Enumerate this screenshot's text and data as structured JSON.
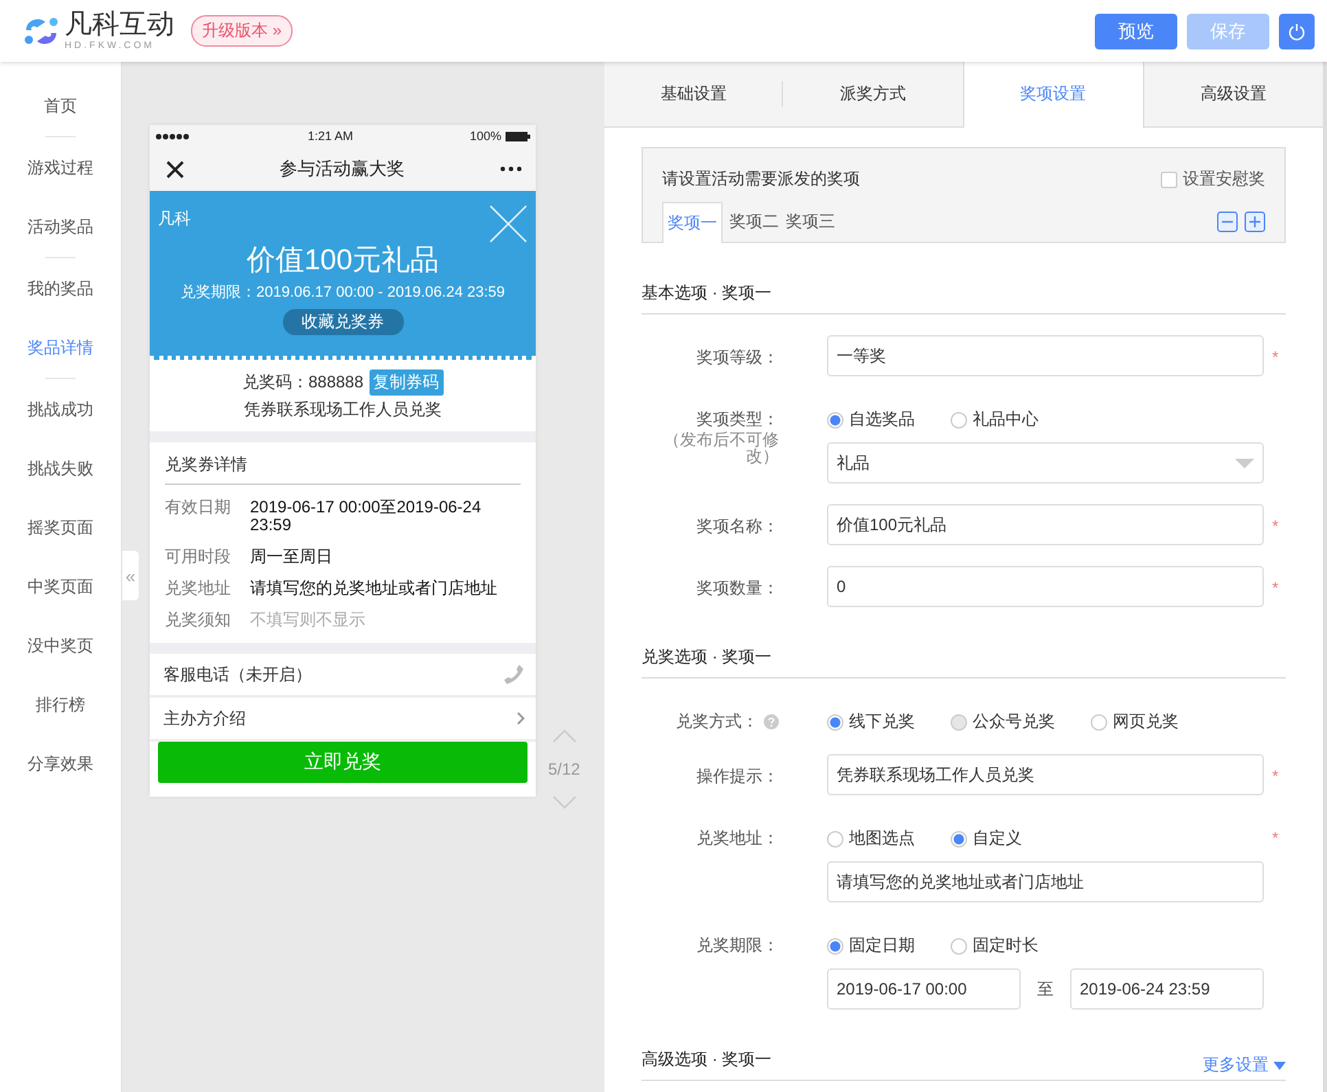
{
  "header": {
    "logo_text": "凡科互动",
    "logo_sub": "HD.FKW.COM",
    "upgrade": "升级版本 »",
    "buttons": [
      {
        "label": "预览",
        "disabled": false
      },
      {
        "label": "保存",
        "disabled": true
      }
    ]
  },
  "sidebar": {
    "groups": [
      [
        {
          "label": "首页",
          "selected": false
        }
      ],
      [
        {
          "label": "游戏过程",
          "selected": false
        },
        {
          "label": "活动奖品",
          "selected": false
        }
      ],
      [
        {
          "label": "我的奖品",
          "selected": false
        },
        {
          "label": "奖品详情",
          "selected": true
        }
      ],
      [
        {
          "label": "挑战成功",
          "selected": false
        },
        {
          "label": "挑战失败",
          "selected": false
        },
        {
          "label": "摇奖页面",
          "selected": false
        },
        {
          "label": "中奖页面",
          "selected": false
        },
        {
          "label": "没中奖页",
          "selected": false
        },
        {
          "label": "排行榜",
          "selected": false
        },
        {
          "label": "分享效果",
          "selected": false
        }
      ]
    ],
    "collapse": "«"
  },
  "phone": {
    "time": "1:21 AM",
    "battery": "100%",
    "title": "参与活动赢大奖",
    "coupon": {
      "brand": "凡科",
      "title": "价值100元礼品",
      "period": "兑奖期限：2019.06.17 00:00 - 2019.06.24 23:59",
      "save": "收藏兑奖券"
    },
    "code": {
      "label": "兑奖码：888888",
      "copy": "复制券码",
      "note": "凭券联系现场工作人员兑奖"
    },
    "details": {
      "title": "兑奖券详情",
      "rows": [
        {
          "label": "有效日期",
          "value": "2019-06-17 00:00至2019-06-24 23:59",
          "muted": false
        },
        {
          "label": "可用时段",
          "value": "周一至周日",
          "muted": false
        },
        {
          "label": "兑奖地址",
          "value": "请填写您的兑奖地址或者门店地址",
          "muted": false
        },
        {
          "label": "兑奖须知",
          "value": "不填写则不显示",
          "muted": true
        }
      ]
    },
    "hotline": "客服电话（未开启）",
    "organizer": "主办方介绍",
    "redeem": "立即兑奖"
  },
  "pager": "5/12",
  "tabs": [
    {
      "label": "基础设置",
      "selected": false
    },
    {
      "label": "派奖方式",
      "selected": false
    },
    {
      "label": "奖项设置",
      "selected": true
    },
    {
      "label": "高级设置",
      "selected": false
    }
  ],
  "prizes": {
    "prompt": "请设置活动需要派发的奖项",
    "consolation": {
      "label": "设置安慰奖",
      "checked": false
    },
    "items": [
      {
        "label": "奖项一",
        "selected": true
      },
      {
        "label": "奖项二",
        "selected": false
      },
      {
        "label": "奖项三",
        "selected": false
      }
    ]
  },
  "form": {
    "sections": [
      {
        "heading": "基本选项 · 奖项一",
        "rows": [
          {
            "kind": "text",
            "label": "奖项等级：",
            "value": "一等奖",
            "required": "*"
          },
          {
            "kind": "radio_select",
            "label": "奖项类型：",
            "note": "（发布后不可修改）",
            "options": [
              {
                "label": "自选奖品",
                "selected": true,
                "disabled": false
              },
              {
                "label": "礼品中心",
                "selected": false,
                "disabled": false
              }
            ],
            "value": "礼品"
          },
          {
            "kind": "text",
            "label": "奖项名称：",
            "value": "价值100元礼品",
            "required": "*"
          },
          {
            "kind": "text",
            "label": "奖项数量：",
            "value": "0",
            "required": "*"
          }
        ]
      },
      {
        "heading": "兑奖选项 · 奖项一",
        "rows": [
          {
            "kind": "radio",
            "label": "兑奖方式：",
            "help": true,
            "options": [
              {
                "label": "线下兑奖",
                "selected": true,
                "disabled": false
              },
              {
                "label": "公众号兑奖",
                "selected": false,
                "disabled": true
              },
              {
                "label": "网页兑奖",
                "selected": false,
                "disabled": false
              }
            ]
          },
          {
            "kind": "text",
            "label": "操作提示：",
            "value": "凭券联系现场工作人员兑奖",
            "required": "*"
          },
          {
            "kind": "radio_text",
            "label": "兑奖地址：",
            "options": [
              {
                "label": "地图选点",
                "selected": false,
                "disabled": false
              },
              {
                "label": "自定义",
                "selected": true,
                "disabled": false
              }
            ],
            "value": "请填写您的兑奖地址或者门店地址",
            "required": "*"
          },
          {
            "kind": "radio_range",
            "label": "兑奖期限：",
            "options": [
              {
                "label": "固定日期",
                "selected": true,
                "disabled": false
              },
              {
                "label": "固定时长",
                "selected": false,
                "disabled": false
              }
            ],
            "from": "2019-06-17 00:00",
            "separator": "至",
            "to": "2019-06-24 23:59"
          }
        ]
      },
      {
        "heading": "高级选项 · 奖项一",
        "more": "更多设置"
      }
    ]
  }
}
